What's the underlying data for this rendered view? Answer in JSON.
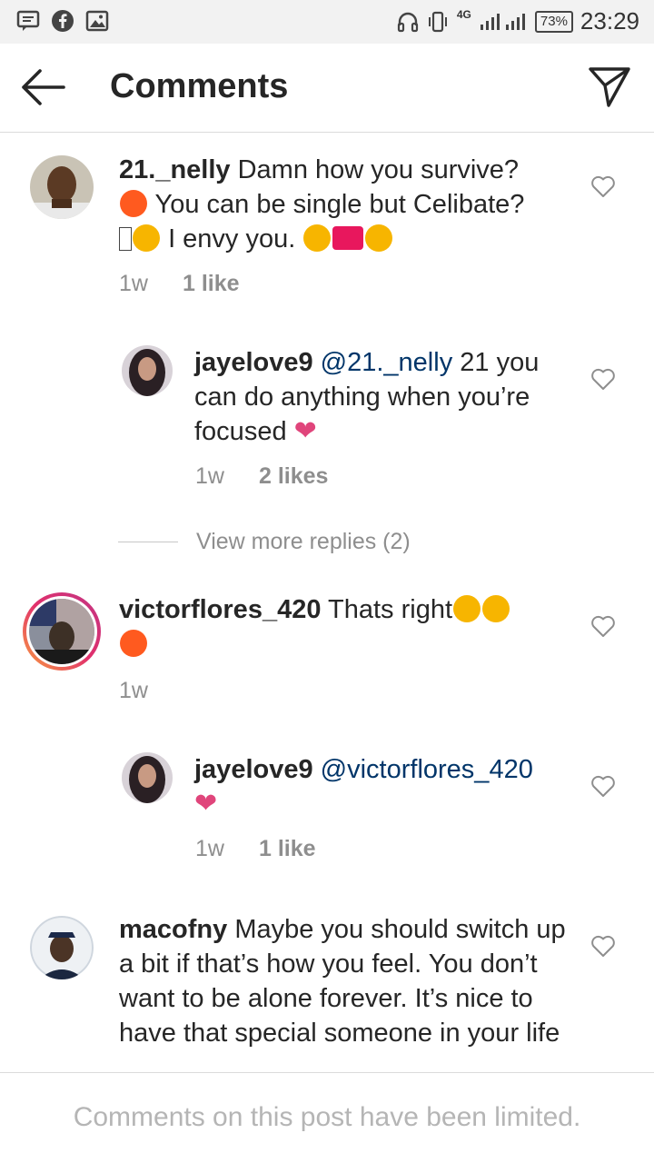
{
  "status_bar": {
    "left_icons": [
      "message-icon",
      "facebook-icon",
      "image-icon"
    ],
    "network": "4G",
    "battery": "73%",
    "time": "23:29"
  },
  "header": {
    "title": "Comments",
    "back_icon": "back-arrow-icon",
    "share_icon": "direct-share-icon"
  },
  "comments": [
    {
      "username": "21._nelly",
      "text_line1": "Damn how you survive?",
      "text_line2": "You can be single but Celibate?",
      "text_line3": "I envy you.",
      "time": "1w",
      "likes": "1 like"
    },
    {
      "username": "jayelove9",
      "mention": "@21._nelly",
      "text": "21 you can do anything when you’re focused",
      "time": "1w",
      "likes": "2 likes"
    },
    {
      "username": "victorflores_420",
      "text": "Thats right",
      "time": "1w"
    },
    {
      "username": "jayelove9",
      "mention": "@victorflores_420",
      "time": "1w",
      "likes": "1 like"
    },
    {
      "username": "macofny",
      "text": "Maybe you should switch up a bit if that’s how you feel. You don’t want to be alone forever. It’s nice to have that special someone in your life"
    }
  ],
  "view_more_replies": "View more replies (2)",
  "footer": {
    "limited_text": "Comments on this post have been limited."
  },
  "colors": {
    "mention": "#003569",
    "meta": "#8e8e8e",
    "story_ring_start": "#f9a03f",
    "story_ring_end": "#c13584"
  }
}
